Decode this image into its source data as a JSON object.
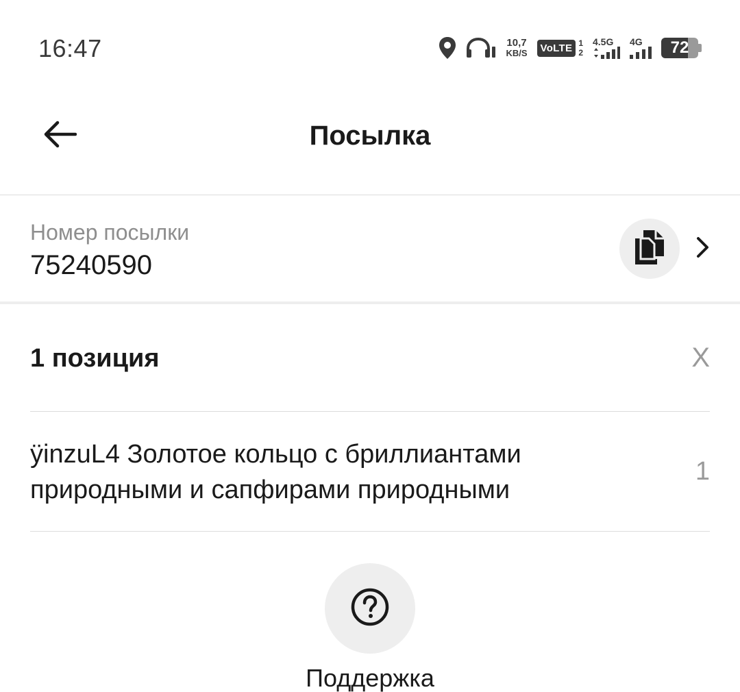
{
  "status_bar": {
    "time": "16:47",
    "speed_value": "10,7",
    "speed_unit": "KB/S",
    "volte": "VoLTE",
    "sim1": "1",
    "sim2": "2",
    "network1": "4.5G",
    "network2": "4G",
    "battery": "72",
    "icons": [
      "location-icon",
      "headphones-icon",
      "volte-badge",
      "signal-icon",
      "battery-icon"
    ]
  },
  "header": {
    "title": "Посылка",
    "back_icon": "arrow-left-icon"
  },
  "parcel": {
    "label": "Номер посылки",
    "number": "75240590",
    "copy_icon": "copy-icon",
    "chevron_icon": "chevron-right-icon"
  },
  "positions": {
    "count_label": "1 позиция",
    "close_label": "X",
    "items": [
      {
        "title": "ÿinzuL4 Золотое кольцо с бриллиантами природными и сапфирами природными",
        "quantity": "1"
      }
    ]
  },
  "support": {
    "label": "Поддержка",
    "icon": "question-circle-icon"
  },
  "colors": {
    "background": "#ffffff",
    "text_primary": "#1a1a1a",
    "text_secondary": "#8e8e8e",
    "circle_bg": "#eeeeee",
    "divider": "#dcdcdc"
  }
}
